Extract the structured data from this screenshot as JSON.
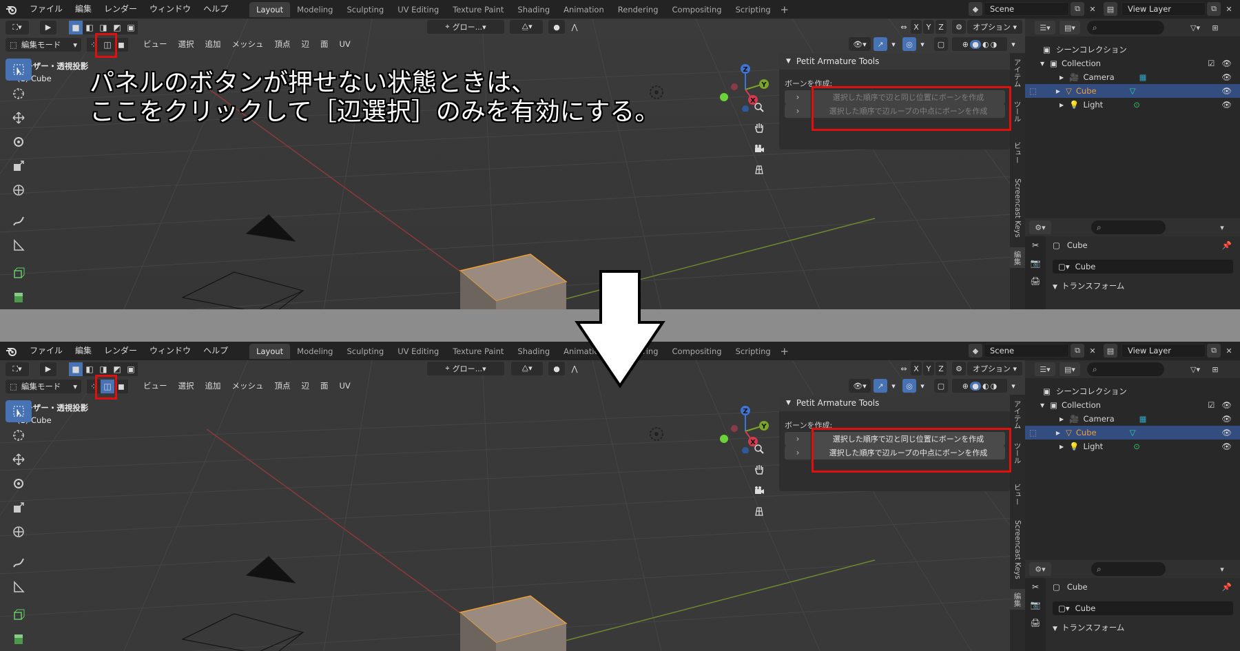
{
  "topbar": {
    "menus": [
      "ファイル",
      "編集",
      "レンダー",
      "ウィンドウ",
      "ヘルプ"
    ],
    "workspaces": [
      "Layout",
      "Modeling",
      "Sculpting",
      "UV Editing",
      "Texture Paint",
      "Shading",
      "Animation",
      "Rendering",
      "Compositing",
      "Scripting"
    ],
    "active_workspace": "Layout",
    "plus": "+",
    "scene": "Scene",
    "view_layer": "View Layer"
  },
  "viewport": {
    "mode": "編集モード",
    "menus": [
      "ビュー",
      "選択",
      "追加",
      "メッシュ",
      "頂点",
      "辺",
      "面",
      "UV"
    ],
    "orientation": "グロー...",
    "axes": [
      "X",
      "Y",
      "Z"
    ],
    "options": "オプション",
    "view_name": "ユーザー・透視投影",
    "object_name": "(1) Cube",
    "gizmo": {
      "x": "X",
      "y": "Y",
      "z": "Z"
    }
  },
  "npanel": {
    "title": "Petit Armature Tools",
    "label": "ボーンを作成:",
    "btn1": "選択した順序で辺と同じ位置にボーンを作成",
    "btn2": "選択した順序で辺ループの中点にボーンを作成",
    "tabs": [
      "アイテム",
      "ツール",
      "ビュー",
      "Screencast Keys",
      "編集"
    ]
  },
  "outliner": {
    "root": "シーンコレクション",
    "collection": "Collection",
    "items": [
      "Camera",
      "Cube",
      "Light"
    ],
    "selected": "Cube"
  },
  "properties": {
    "object": "Cube",
    "data_name": "Cube",
    "section": "トランスフォーム"
  },
  "annotation": {
    "line1": "パネルのボタンが押せない状態ときは、",
    "line2": "ここをクリックして［辺選択］のみを有効にする。"
  },
  "colors": {
    "selection_blue": "#4772b3",
    "highlight_red": "#e01010",
    "object_orange": "#f0a030"
  }
}
